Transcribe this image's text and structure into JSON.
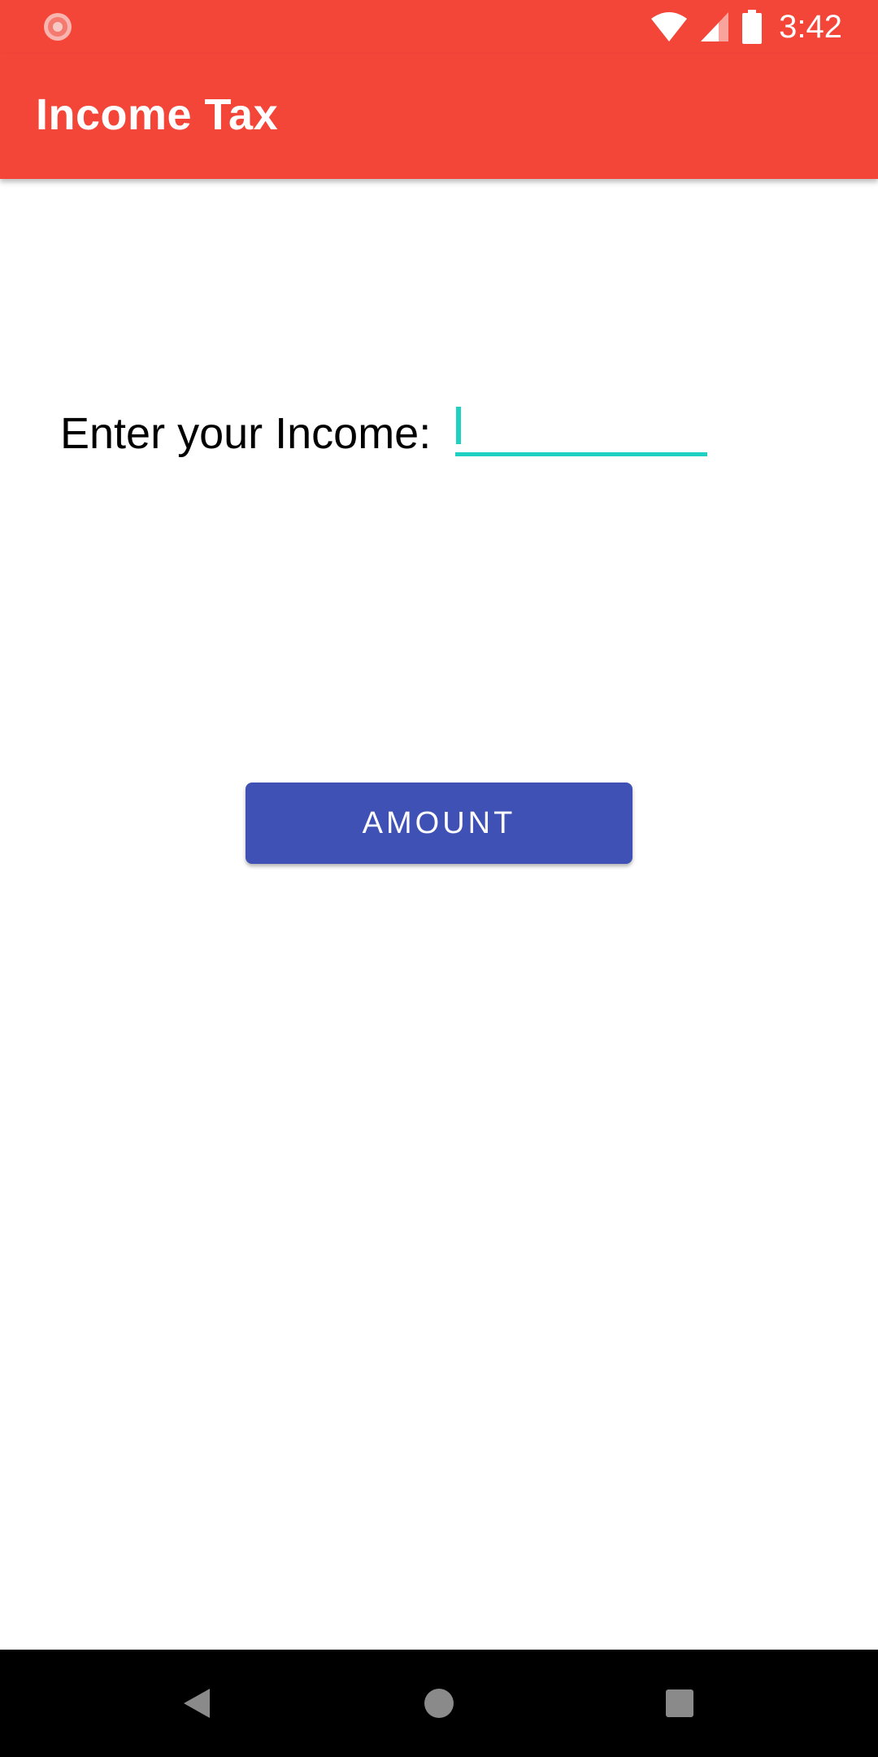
{
  "status_bar": {
    "time": "3:42",
    "icons": [
      "app-notification-icon",
      "wifi-icon",
      "cell-signal-icon",
      "battery-icon"
    ],
    "background_color": "#f44539"
  },
  "app_bar": {
    "title": "Income Tax",
    "background_color": "#f44539"
  },
  "form": {
    "income_label": "Enter your Income:",
    "income_value": "",
    "accent_color": "#1fd1c1"
  },
  "action": {
    "button_label": "AMOUNT",
    "button_color": "#3f51b5"
  },
  "nav_bar": {
    "buttons": [
      "back-icon",
      "home-icon",
      "recents-icon"
    ]
  }
}
